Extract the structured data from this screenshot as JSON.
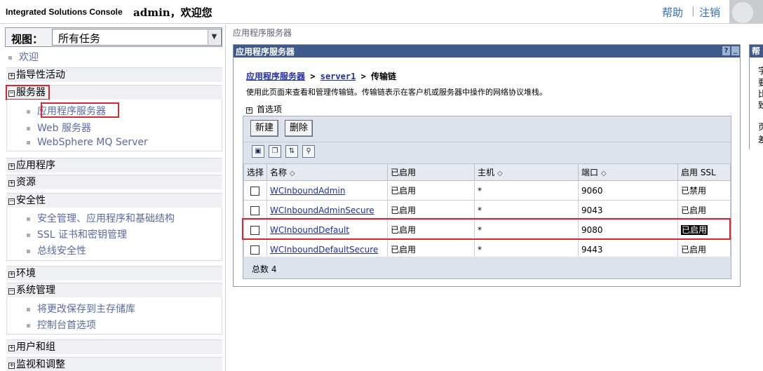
{
  "banner": {
    "app_title": "Integrated Solutions Console",
    "welcome": "admin，欢迎您",
    "help": "帮助",
    "separator": "|",
    "logout": "注销"
  },
  "nav": {
    "view_label": "视图：",
    "view_value": "所有任务",
    "welcome": "欢迎",
    "groups": {
      "guided": "指导性活动",
      "servers": "服务器",
      "applications": "应用程序",
      "resources": "资源",
      "security": "安全性",
      "environment": "环境",
      "sysadmin": "系统管理",
      "users_groups": "用户和组",
      "monitoring": "监视和调整"
    },
    "servers_items": [
      "应用程序服务器",
      "Web 服务器",
      "WebSphere MQ Server"
    ],
    "security_items": [
      "安全管理、应用程序和基础结构",
      "SSL 证书和密钥管理",
      "总线安全性"
    ],
    "sysadmin_items": [
      "将更改保存到主存储库",
      "控制台首选项"
    ],
    "expanded_marker": "⊟",
    "collapsed_marker": "⊞"
  },
  "main": {
    "top_breadcrumb": "应用程序服务器",
    "panel_title": "应用程序服务器",
    "panel_help": "?",
    "panel_min": "_",
    "crumb_1": "应用程序服务器",
    "crumb_sep": ">",
    "crumb_2": "server1",
    "crumb_3": "传输链",
    "description": "使用此页面来查看和管理传输链。传输链表示在客户机或服务器中操作的网络协议堆栈。",
    "preferences": "首选项",
    "buttons": {
      "new": "新建",
      "delete": "删除"
    },
    "columns": [
      "选择",
      "名称",
      "已启用",
      "主机",
      "端口",
      "启用 SSL"
    ],
    "rows": [
      {
        "name": "WCInboundAdmin",
        "enabled": "已启用",
        "host": "*",
        "port": "9060",
        "ssl": "已禁用"
      },
      {
        "name": "WCInboundAdminSecure",
        "enabled": "已启用",
        "host": "*",
        "port": "9043",
        "ssl": "已启用"
      },
      {
        "name": "WCInboundDefault",
        "enabled": "已启用",
        "host": "*",
        "port": "9080",
        "ssl": "已启用"
      },
      {
        "name": "WCInboundDefaultSecure",
        "enabled": "已启用",
        "host": "*",
        "port": "9443",
        "ssl": "已启用"
      }
    ],
    "total": "总数 4"
  },
  "help_panel": {
    "title": "帮",
    "fragments": [
      "字",
      "要",
      "比",
      "致",
      "页",
      "差"
    ]
  },
  "colors": {
    "panel_header": "#3d5a8b",
    "link": "#1f2ea6",
    "highlight_box": "#d8282f",
    "nav_text": "#5a6aa5"
  }
}
